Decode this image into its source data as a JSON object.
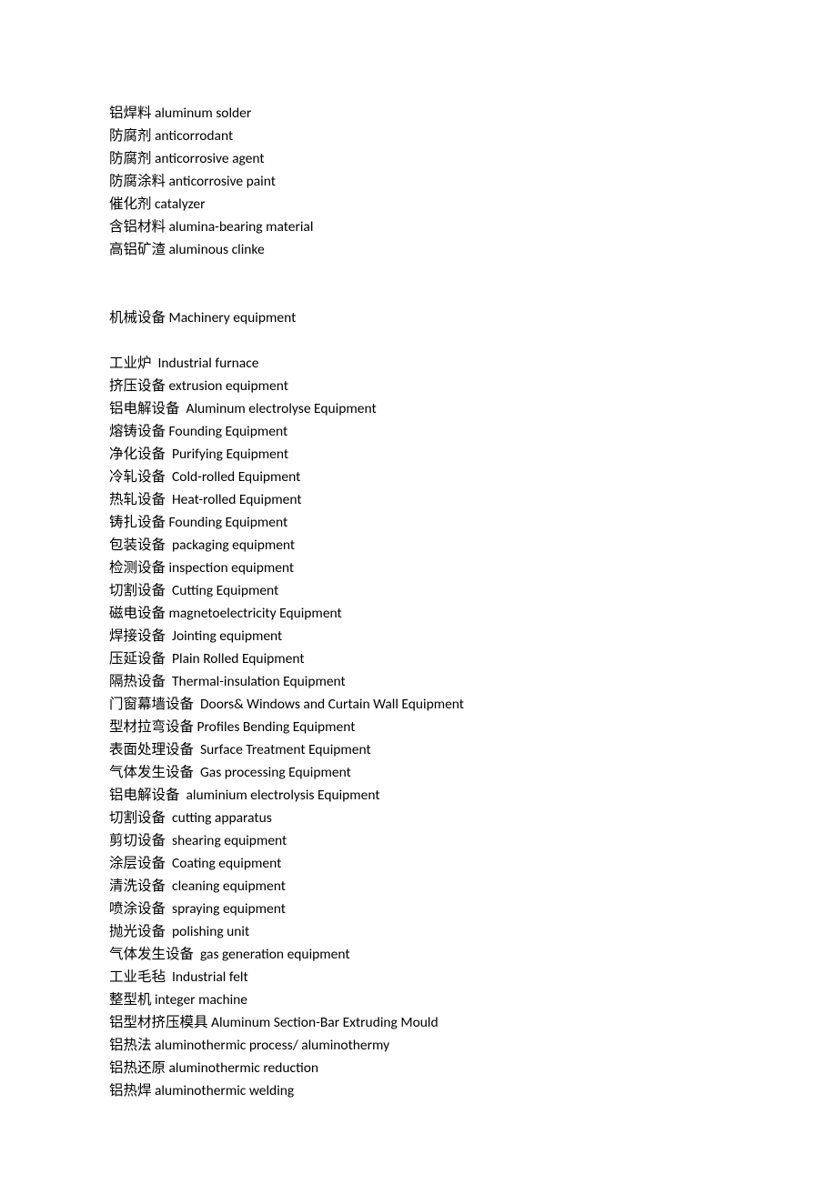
{
  "group1": [
    "铝焊料 aluminum solder",
    "防腐剂 anticorrodant",
    "防腐剂 anticorrosive agent",
    "防腐涂料 anticorrosive paint",
    "催化剂 catalyzer",
    "含铝材料 alumina-bearing material",
    "高铝矿渣 aluminous clinke"
  ],
  "heading": "机械设备 Machinery equipment",
  "group2": [
    "工业炉  Industrial furnace",
    "挤压设备 extrusion equipment",
    "铝电解设备  Aluminum electrolyse Equipment",
    "熔铸设备 Founding Equipment",
    "净化设备  Purifying Equipment",
    "冷轧设备  Cold-rolled Equipment",
    "热轧设备  Heat-rolled Equipment",
    "铸扎设备 Founding Equipment",
    "包装设备  packaging equipment",
    "检测设备 inspection equipment",
    "切割设备  Cutting Equipment",
    "磁电设备 magnetoelectricity Equipment",
    "焊接设备  Jointing equipment",
    "压延设备  Plain Rolled Equipment",
    "隔热设备  Thermal-insulation Equipment",
    "门窗幕墙设备  Doors& Windows and Curtain Wall Equipment",
    "型材拉弯设备 Profiles Bending Equipment",
    "表面处理设备  Surface Treatment Equipment",
    "气体发生设备  Gas processing Equipment",
    "铝电解设备  aluminium electrolysis Equipment",
    "切割设备  cutting apparatus",
    "剪切设备  shearing equipment",
    "涂层设备  Coating equipment",
    "清洗设备  cleaning equipment",
    "喷涂设备  spraying equipment",
    "抛光设备  polishing unit",
    "气体发生设备  gas generation equipment",
    "工业毛毡  Industrial felt",
    "整型机 integer machine",
    "铝型材挤压模具 Aluminum Section-Bar Extruding Mould",
    "铝热法 aluminothermic process/ aluminothermy",
    "铝热还原 aluminothermic reduction",
    "铝热焊 aluminothermic welding"
  ]
}
